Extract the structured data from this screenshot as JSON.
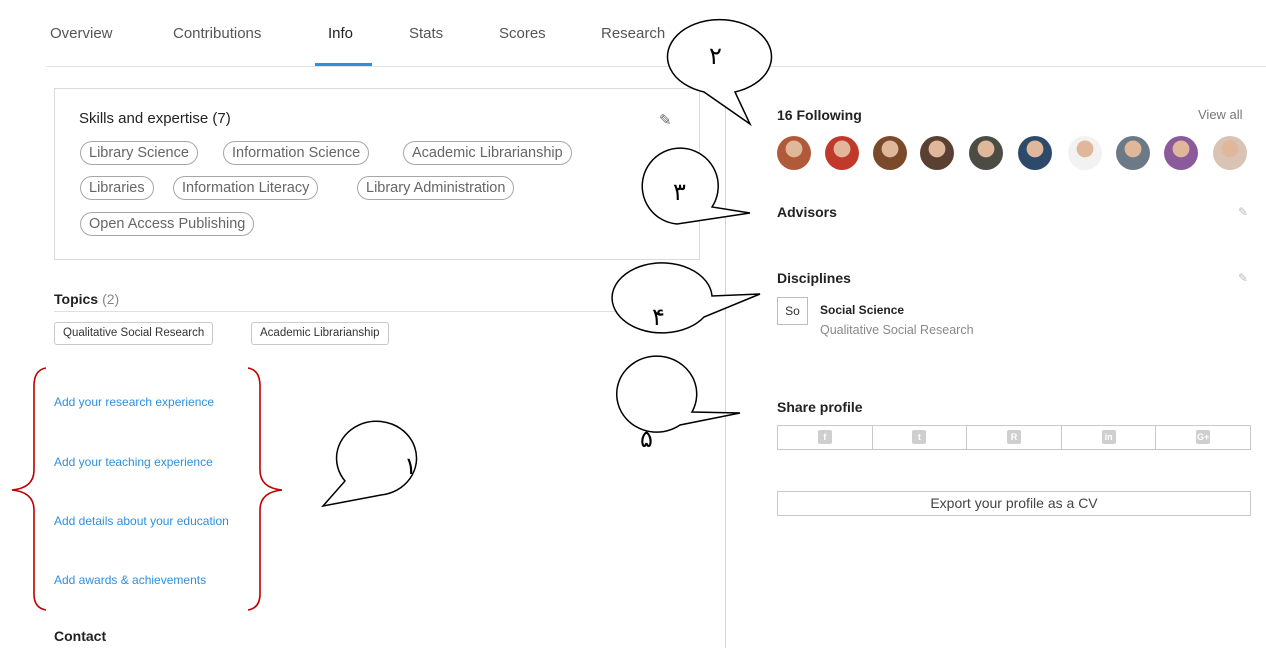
{
  "tabs": [
    {
      "label": "Overview"
    },
    {
      "label": "Contributions"
    },
    {
      "label": "Info",
      "active": true
    },
    {
      "label": "Stats"
    },
    {
      "label": "Scores"
    },
    {
      "label": "Research"
    }
  ],
  "skills": {
    "title": "Skills and expertise (7)",
    "items": [
      "Library Science",
      "Information Science",
      "Academic Librarianship",
      "Libraries",
      "Information Literacy",
      "Library Administration",
      "Open Access Publishing"
    ]
  },
  "topics": {
    "title": "Topics",
    "count": "(2)",
    "items": [
      "Qualitative Social Research",
      "Academic Librarianship"
    ]
  },
  "add_links": [
    "Add your research experience",
    "Add your teaching experience",
    "Add details about your education",
    "Add awards & achievements"
  ],
  "contact": {
    "title": "Contact"
  },
  "following": {
    "title": "16 Following",
    "view_all": "View all",
    "avatars": [
      "#b05a3a",
      "#c0392b",
      "#7a4a2a",
      "#5a4032",
      "#4c4c44",
      "#2d4a6a",
      "#f2f2f2",
      "#6b7a86",
      "#8a5a9a",
      "#d9c3b5"
    ]
  },
  "advisors": {
    "title": "Advisors"
  },
  "disciplines": {
    "title": "Disciplines",
    "badge": "So",
    "name": "Social Science",
    "sub": "Qualitative Social Research"
  },
  "share": {
    "title": "Share profile",
    "icons": [
      {
        "name": "facebook-icon",
        "glyph": "f"
      },
      {
        "name": "twitter-icon",
        "glyph": "t"
      },
      {
        "name": "researchgate-icon",
        "glyph": "R"
      },
      {
        "name": "linkedin-icon",
        "glyph": "in"
      },
      {
        "name": "google-plus-icon",
        "glyph": "G+"
      }
    ]
  },
  "export": {
    "label": "Export your profile as a CV"
  },
  "annotations": {
    "n1": "١",
    "n2": "٢",
    "n3": "٣",
    "n4": "۴",
    "n5": "۵"
  },
  "colors": {
    "accent": "#2f8fdc",
    "bracket": "#c00000"
  }
}
